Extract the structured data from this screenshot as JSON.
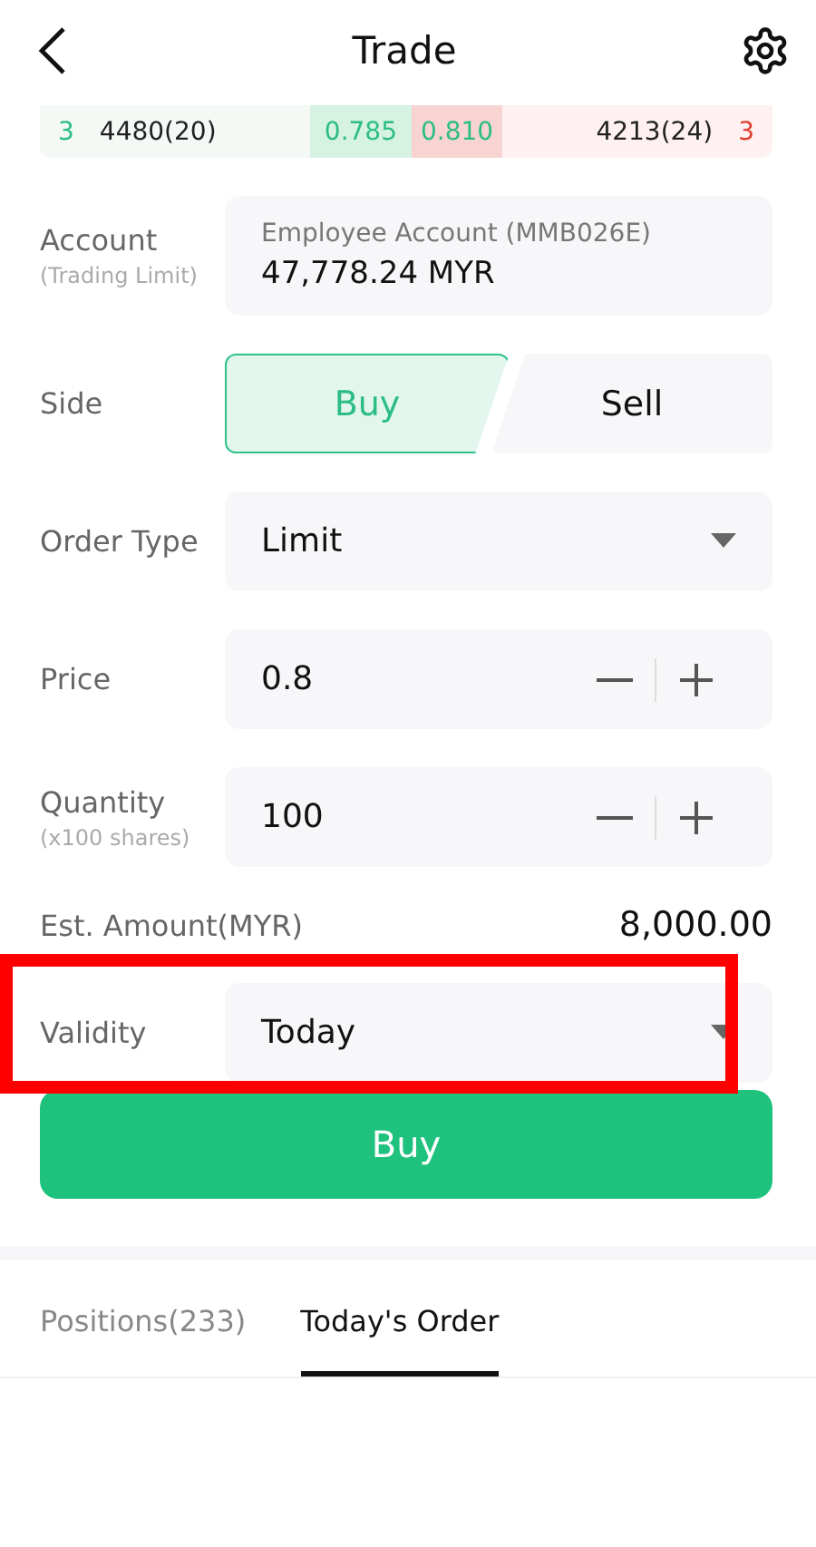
{
  "header": {
    "title": "Trade"
  },
  "quote": {
    "bid_level": "3",
    "bid_volume": "4480(20)",
    "bid_price": "0.785",
    "ask_price": "0.810",
    "ask_volume": "4213(24)",
    "ask_level": "3"
  },
  "account": {
    "label": "Account",
    "sublabel": "(Trading Limit)",
    "name": "Employee Account (MMB026E)",
    "value": "47,778.24 MYR"
  },
  "side": {
    "label": "Side",
    "options": [
      {
        "label": "Buy",
        "selected": true
      },
      {
        "label": "Sell",
        "selected": false
      }
    ]
  },
  "fields": [
    {
      "kind": "select",
      "label": "Order Type",
      "value": "Limit",
      "highlighted": false
    },
    {
      "kind": "stepper",
      "label": "Price",
      "value": "0.8"
    },
    {
      "kind": "stepper",
      "label": "Quantity",
      "sublabel": "(x100 shares)",
      "value": "100"
    },
    {
      "kind": "amount",
      "label": "Est. Amount(MYR)",
      "value": "8,000.00"
    },
    {
      "kind": "select",
      "label": "Validity",
      "value": "Today",
      "highlighted": true
    }
  ],
  "submit": "Buy",
  "tabs": [
    {
      "label": "Positions(233)",
      "selected": false
    },
    {
      "label": "Today's Order",
      "selected": true
    }
  ]
}
